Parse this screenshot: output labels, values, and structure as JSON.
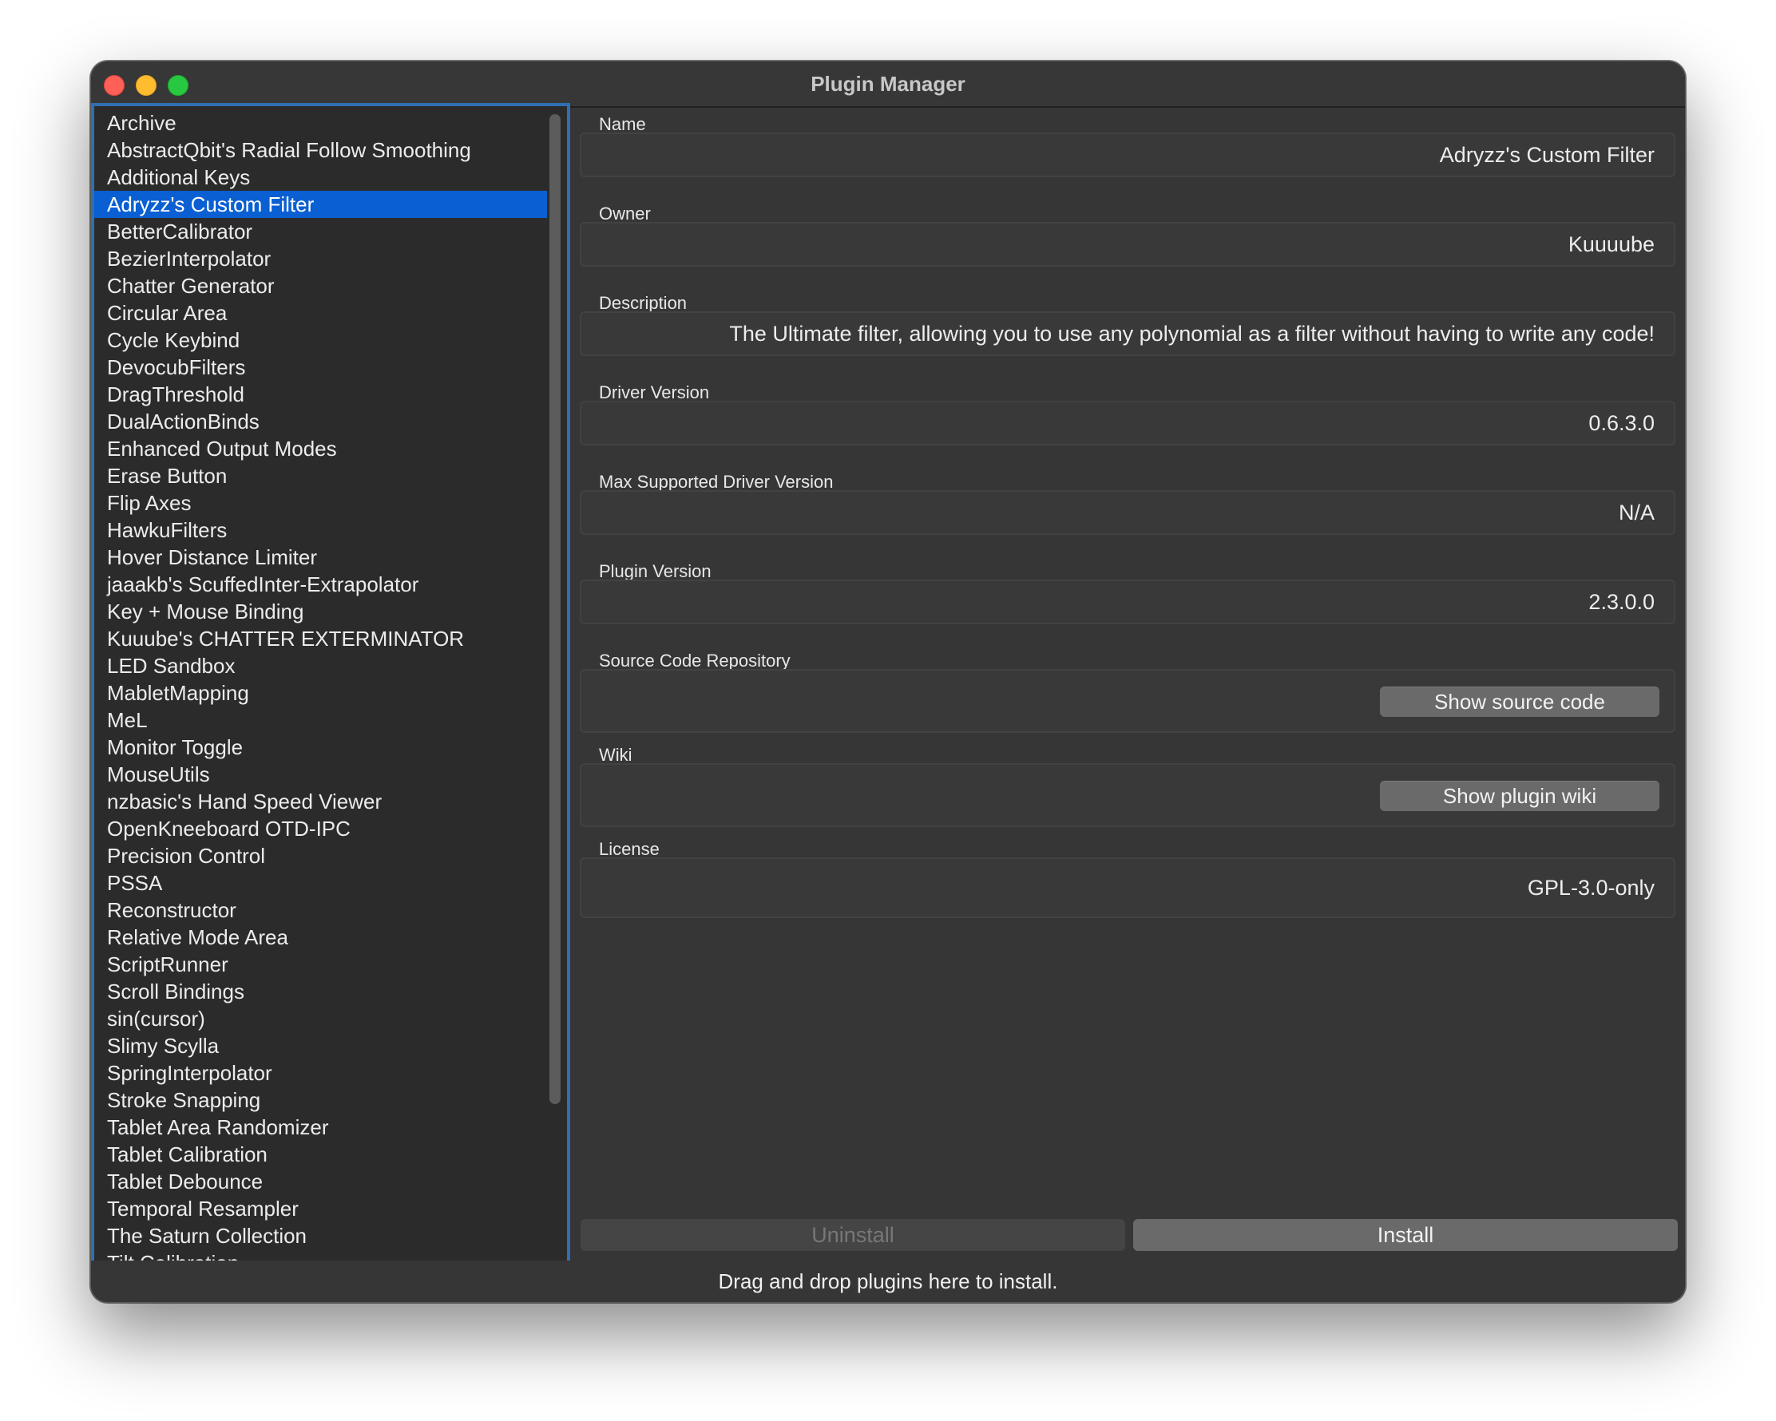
{
  "window": {
    "title": "Plugin Manager"
  },
  "plugins": {
    "selected_index": 3,
    "items": [
      "Archive",
      "AbstractQbit's Radial Follow Smoothing",
      "Additional Keys",
      "Adryzz's Custom Filter",
      "BetterCalibrator",
      "BezierInterpolator",
      "Chatter Generator",
      "Circular Area",
      "Cycle Keybind",
      "DevocubFilters",
      "DragThreshold",
      "DualActionBinds",
      "Enhanced Output Modes",
      "Erase Button",
      "Flip Axes",
      "HawkuFilters",
      "Hover Distance Limiter",
      "jaaakb's ScuffedInter-Extrapolator",
      "Key + Mouse Binding",
      "Kuuube's CHATTER EXTERMINATOR",
      "LED Sandbox",
      "MabletMapping",
      "MeL",
      "Monitor Toggle",
      "MouseUtils",
      "nzbasic's Hand Speed Viewer",
      "OpenKneeboard OTD-IPC",
      "Precision Control",
      "PSSA",
      "Reconstructor",
      "Relative Mode Area",
      "ScriptRunner",
      "Scroll Bindings",
      "sin(cursor)",
      "Slimy Scylla",
      "SpringInterpolator",
      "Stroke Snapping",
      "Tablet Area Randomizer",
      "Tablet Calibration",
      "Tablet Debounce",
      "Temporal Resampler",
      "The Saturn Collection",
      "Tilt Calibration"
    ]
  },
  "details": {
    "name_label": "Name",
    "name_value": "Adryzz's Custom Filter",
    "owner_label": "Owner",
    "owner_value": "Kuuuube",
    "description_label": "Description",
    "description_value": "The Ultimate filter, allowing you to use any polynomial as a filter without having to write any code!",
    "driver_version_label": "Driver Version",
    "driver_version_value": "0.6.3.0",
    "max_driver_version_label": "Max Supported Driver Version",
    "max_driver_version_value": "N/A",
    "plugin_version_label": "Plugin Version",
    "plugin_version_value": "2.3.0.0",
    "source_label": "Source Code Repository",
    "source_button": "Show source code",
    "wiki_label": "Wiki",
    "wiki_button": "Show plugin wiki",
    "license_label": "License",
    "license_value": "GPL-3.0-only"
  },
  "actions": {
    "uninstall_label": "Uninstall",
    "install_label": "Install",
    "uninstall_enabled": false
  },
  "status": {
    "drop_hint": "Drag and drop plugins here to install."
  },
  "colors": {
    "selection": "#0a60d2",
    "focus_ring": "#2f6fb3",
    "window_bg": "#363636"
  }
}
